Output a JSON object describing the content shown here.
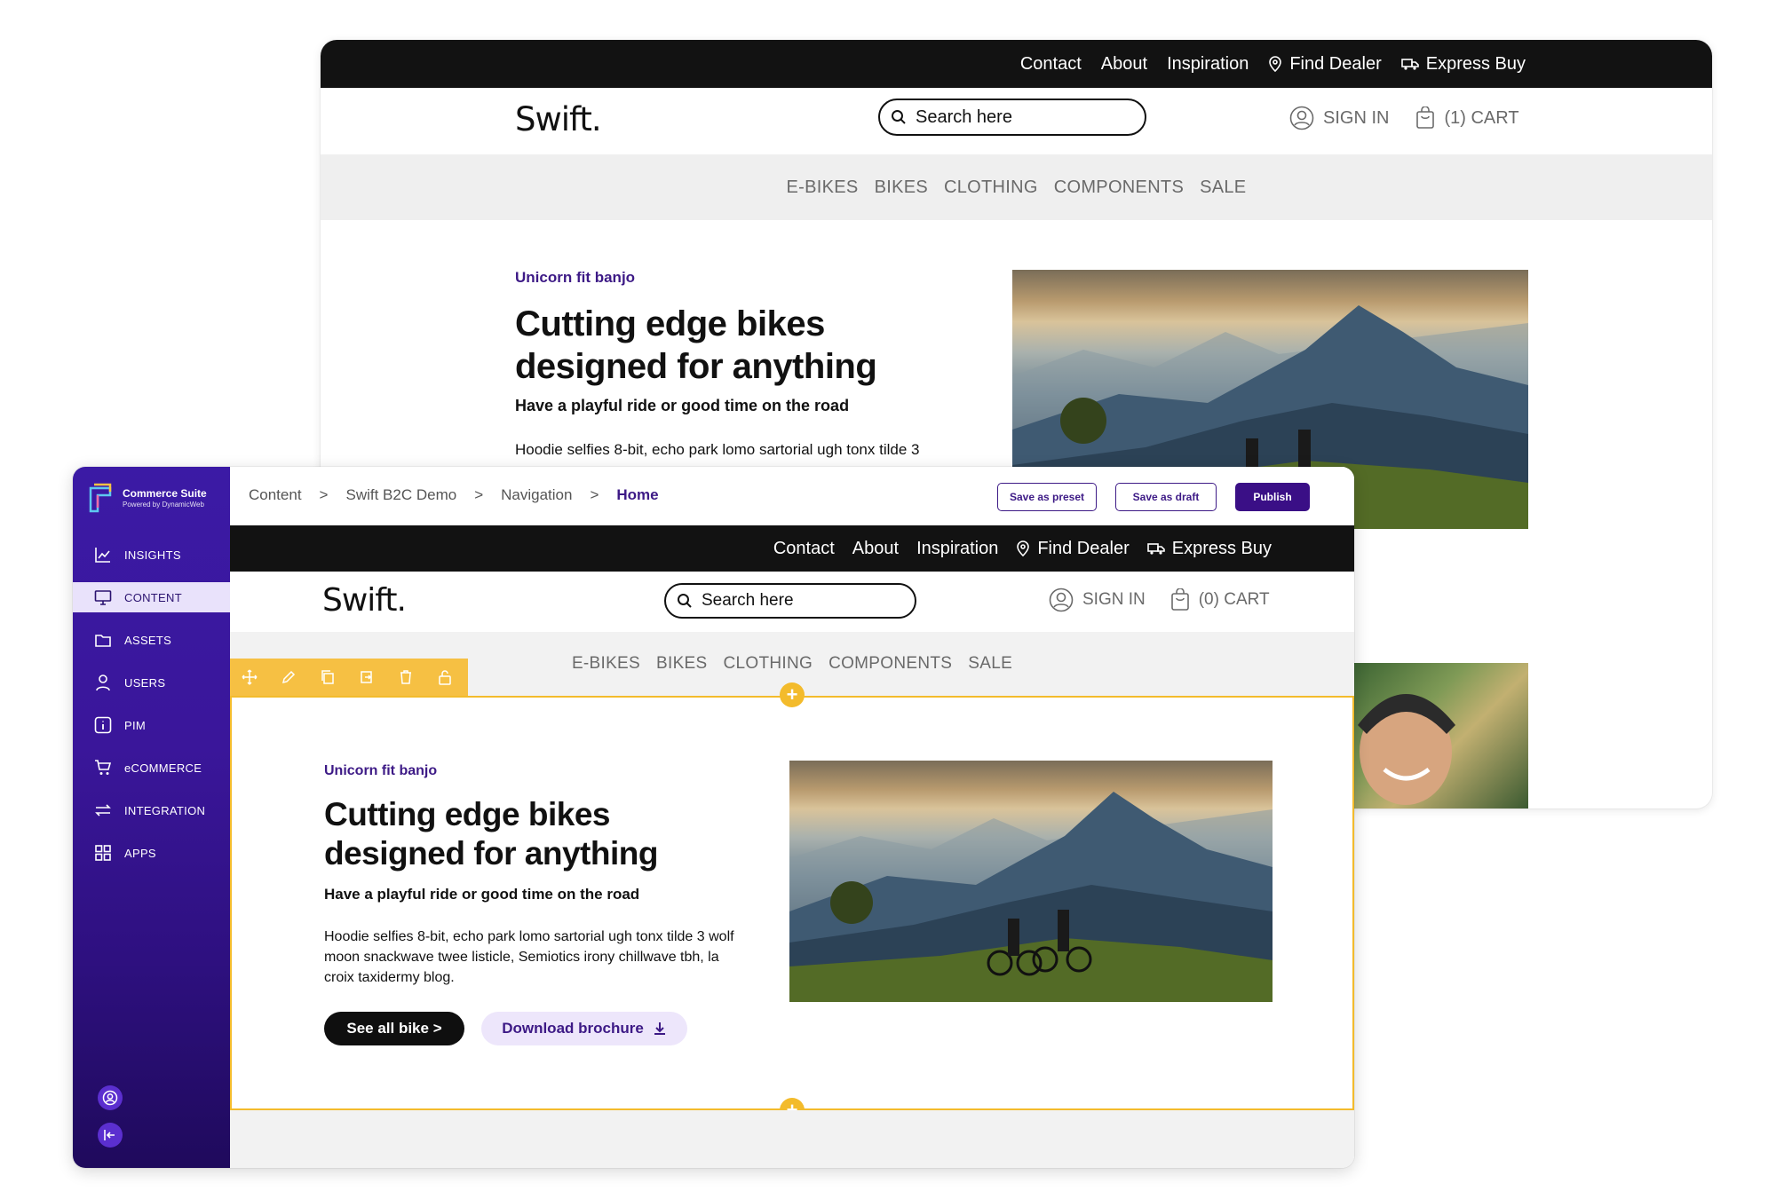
{
  "site": {
    "top_links": [
      "Contact",
      "About",
      "Inspiration",
      "Find Dealer",
      "Express Buy"
    ],
    "logo": "Swift.",
    "search_placeholder": "Search here",
    "sign_in": "SIGN IN",
    "nav": [
      "E-BIKES",
      "BIKES",
      "CLOTHING",
      "COMPONENTS",
      "SALE"
    ],
    "hero": {
      "eyebrow": "Unicorn fit banjo",
      "headline_line1": "Cutting edge bikes",
      "headline_line2": "designed for anything",
      "subhead": "Have a playful ride or good time on the road",
      "body": "Hoodie selfies 8-bit, echo park lomo sartorial ugh tonx tilde 3 wolf moon snackwave twee listicle, Semiotics irony chillwave tbh, la croix taxidermy blog.",
      "body_back": "Hoodie selfies 8-bit, echo park lomo sartorial ugh tonx tilde 3",
      "cta_primary": "See all bike >",
      "cta_secondary": "Download brochure"
    }
  },
  "back_window": {
    "cart": "(1) CART"
  },
  "editor": {
    "brand_name": "Commerce Suite",
    "brand_tag": "Powered by DynamicWeb",
    "sidebar_items": [
      {
        "label": "INSIGHTS",
        "icon": "chart-icon"
      },
      {
        "label": "CONTENT",
        "icon": "monitor-icon",
        "active": true
      },
      {
        "label": "ASSETS",
        "icon": "folder-icon"
      },
      {
        "label": "USERS",
        "icon": "user-icon"
      },
      {
        "label": "PIM",
        "icon": "info-icon"
      },
      {
        "label": "eCOMMERCE",
        "icon": "cart-icon"
      },
      {
        "label": "INTEGRATION",
        "icon": "arrows-icon"
      },
      {
        "label": "APPS",
        "icon": "grid-icon"
      }
    ],
    "breadcrumb": [
      "Content",
      "Swift B2C Demo",
      "Navigation",
      "Home"
    ],
    "breadcrumb_sep": ">",
    "buttons": {
      "save_preset": "Save as preset",
      "save_draft": "Save as draft",
      "publish": "Publish"
    },
    "cart": "(0) CART",
    "block_toolbar_icons": [
      "move-icon",
      "edit-icon",
      "copy-icon",
      "duplicate-icon",
      "trash-icon",
      "unlock-icon"
    ],
    "colors": {
      "accent": "#3d1a86",
      "sidebar": "#3b1aa5",
      "selection": "#f3bb2c"
    }
  }
}
